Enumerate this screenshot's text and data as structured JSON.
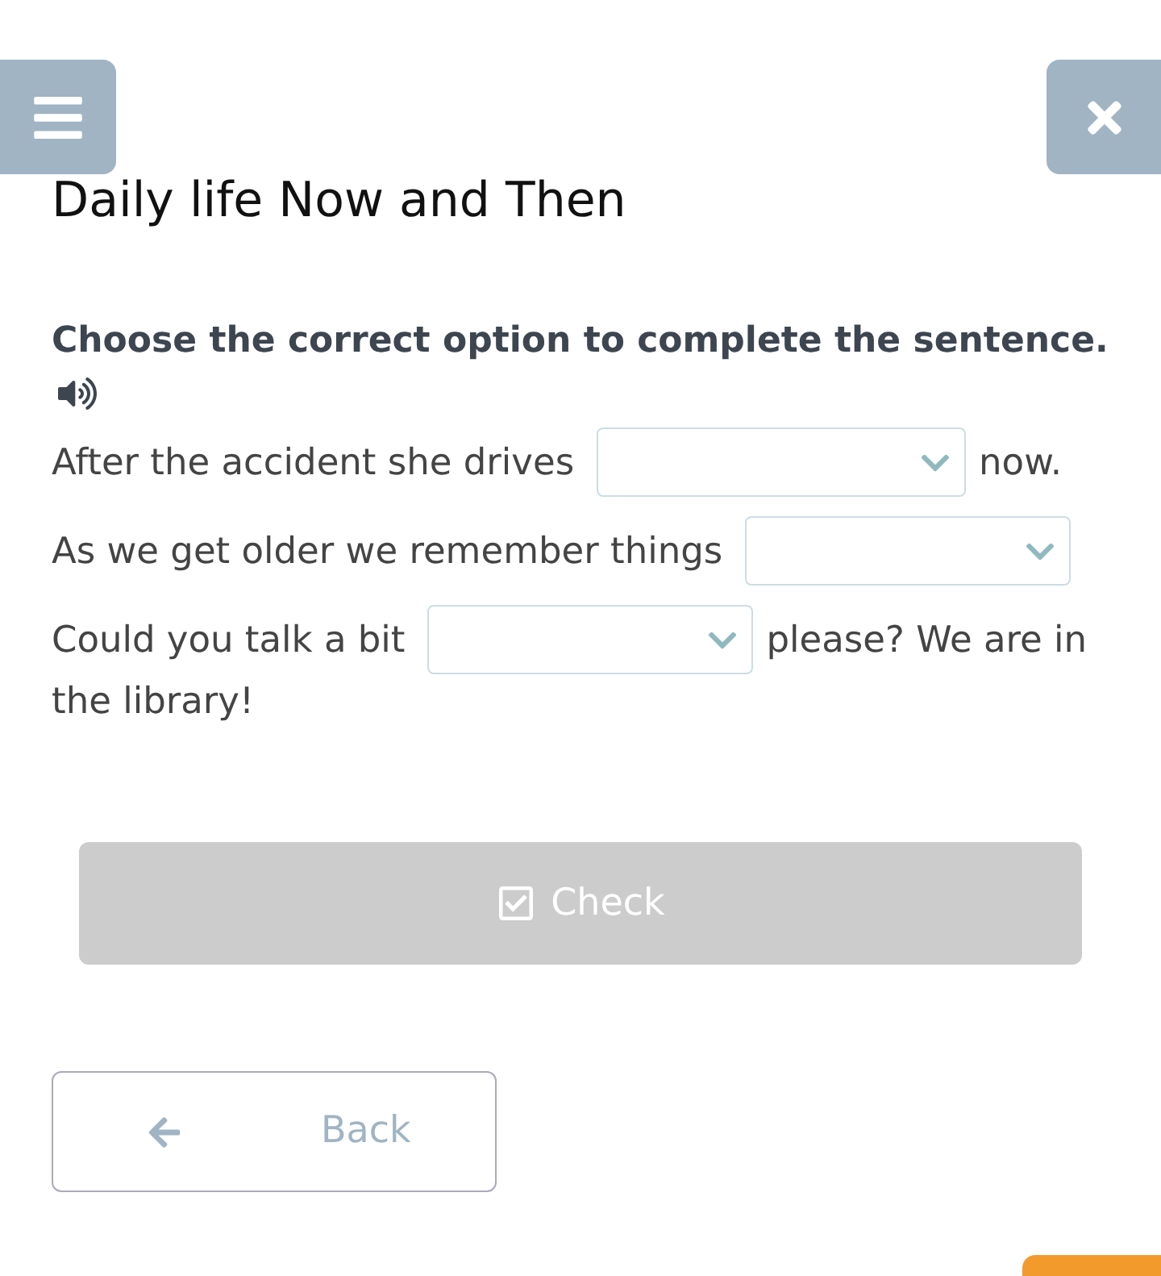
{
  "title": "Daily life Now and Then",
  "instruction": "Choose the correct option to complete the sentence.",
  "sentences": [
    {
      "before": "After the accident she drives",
      "after": "now."
    },
    {
      "before": "As we get older we remember things"
    },
    {
      "before": "Could you talk a bit",
      "after": "please? We are in",
      "continued": "the library!"
    }
  ],
  "check_button": {
    "label": "Check",
    "disabled": true
  },
  "back_button": {
    "label": "Back"
  }
}
